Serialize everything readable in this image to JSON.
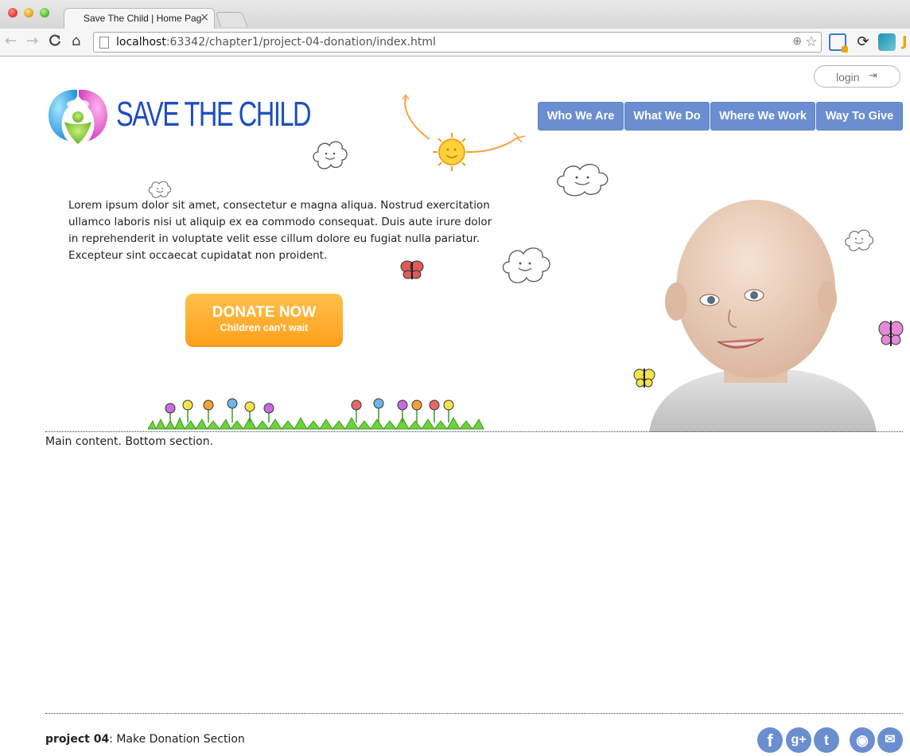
{
  "browser": {
    "tab_title": "Save The Child | Home Page",
    "tab_close": "×",
    "url_host": "localhost",
    "url_path": ":63342/chapter1/project-04-donation/index.html",
    "back_icon": "←",
    "forward_icon": "→",
    "reload_icon": "C",
    "home_icon": "⌂",
    "zoom_icon": "⊕",
    "star_icon": "☆",
    "ext_sync_icon": "⟳",
    "ext_last_letter": "J"
  },
  "header": {
    "login_label": "login",
    "login_icon": "⇥",
    "logo_text": "SAVE THE CHILD",
    "nav": [
      "Who We Are",
      "What We Do",
      "Where We Work",
      "Way To Give"
    ]
  },
  "hero": {
    "intro": "Lorem ipsum dolor sit amet, consectetur e magna aliqua. Nostrud exercitation ullamco laboris nisi ut aliquip ex ea commodo consequat. Duis aute irure dolor in reprehenderit in voluptate velit esse cillum dolore eu fugiat nulla pariatur. Excepteur sint occaecat cupidatat non proident.",
    "donate_main": "DONATE NOW",
    "donate_sub": "Children can't wait"
  },
  "main": {
    "content_text": "Main content. Bottom section."
  },
  "footer": {
    "project_label": "project 04",
    "project_desc": ": Make Donation Section",
    "social": {
      "facebook": "f",
      "google_plus": "g+",
      "twitter": "t",
      "rss": "◉",
      "mail": "✉"
    }
  },
  "colors": {
    "nav_bg": "#6b8ed0",
    "logo_blue": "#1f4fbf",
    "donate_orange": "#ffa01a"
  }
}
